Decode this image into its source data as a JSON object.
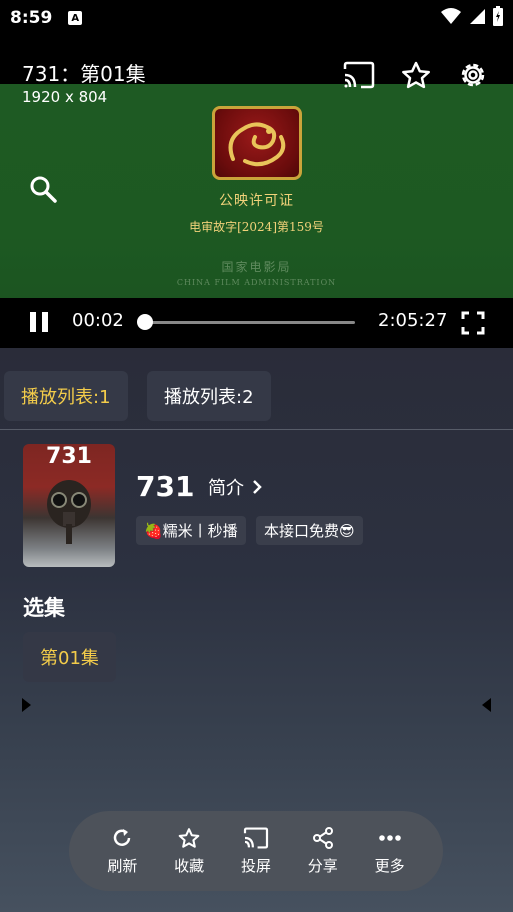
{
  "status_bar": {
    "time": "8:59",
    "app_icon_letter": "A"
  },
  "player": {
    "title": "731：第01集",
    "resolution": "1920 x 804",
    "license": {
      "title": "公映许可证",
      "number": "电审故字[2024]第159号",
      "bureau_cn": "国家电影局",
      "bureau_en": "CHINA FILM ADMINISTRATION"
    },
    "current_time": "00:02",
    "total_time": "2:05:27",
    "progress_fraction": 0.0003
  },
  "playlists": [
    {
      "label": "播放列表:1",
      "active": true
    },
    {
      "label": "播放列表:2",
      "active": false
    }
  ],
  "show": {
    "poster_text": "731",
    "title": "731",
    "intro_label": "简介",
    "tags": [
      "🍓糯米丨秒播",
      "本接口免费😎"
    ]
  },
  "episodes": {
    "section_title": "选集",
    "items": [
      "第01集"
    ]
  },
  "actions": [
    {
      "label": "刷新",
      "icon": "refresh-icon"
    },
    {
      "label": "收藏",
      "icon": "star-icon"
    },
    {
      "label": "投屏",
      "icon": "cast-icon"
    },
    {
      "label": "分享",
      "icon": "share-icon"
    },
    {
      "label": "更多",
      "icon": "more-icon"
    }
  ],
  "colors": {
    "accent": "#f3cc4a",
    "video_bg": "#1e5a23",
    "panel_bg": "#2c3140"
  }
}
